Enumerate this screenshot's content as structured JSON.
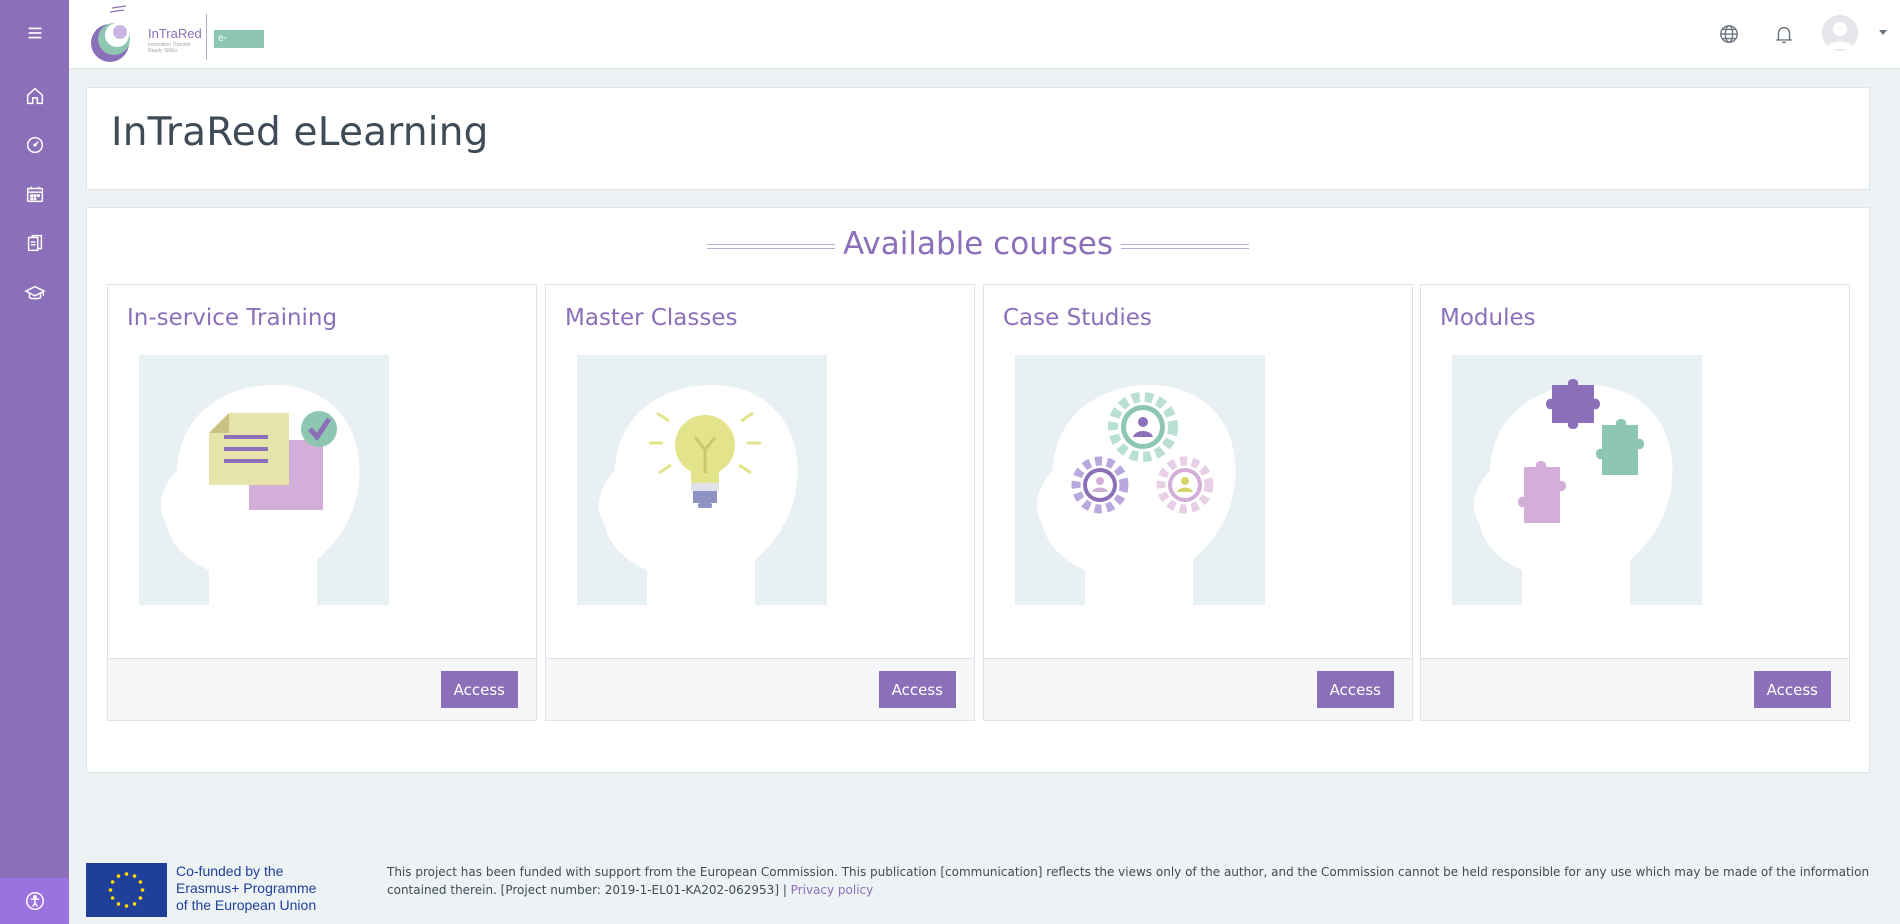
{
  "app": {
    "logo_name": "InTraRed",
    "logo_tagline": "Innovation Transfer Ready SMEs",
    "logo_badge": "e-learning"
  },
  "sidebar": {
    "items": [
      {
        "name": "menu",
        "icon": "hamburger-icon"
      },
      {
        "name": "home",
        "icon": "home-icon"
      },
      {
        "name": "dashboard",
        "icon": "dashboard-icon"
      },
      {
        "name": "calendar",
        "icon": "calendar-icon"
      },
      {
        "name": "content-bank",
        "icon": "files-icon"
      },
      {
        "name": "my-courses",
        "icon": "graduation-cap-icon"
      }
    ],
    "accessibility_icon": "accessibility-icon"
  },
  "header": {
    "icons": [
      "globe-icon",
      "bell-icon",
      "user-avatar"
    ]
  },
  "page": {
    "title": "InTraRed eLearning"
  },
  "courses": {
    "heading": "Available courses",
    "items": [
      {
        "title": "In-service Training",
        "button": "Access",
        "image": "document-check-icon"
      },
      {
        "title": "Master Classes",
        "button": "Access",
        "image": "lightbulb-icon"
      },
      {
        "title": "Case Studies",
        "button": "Access",
        "image": "people-gears-icon"
      },
      {
        "title": "Modules",
        "button": "Access",
        "image": "puzzle-icon"
      }
    ]
  },
  "footer": {
    "eu_line1": "Co-funded by the",
    "eu_line2": "Erasmus+ Programme",
    "eu_line3": "of the European Union",
    "disclaimer": "This project has been funded with support from the European Commission. This publication [communication] reflects the views only of the author, and the Commission cannot be held responsible for any use which may be made of the information contained therein. [Project number: 2019-1-EL01-KA202-062953] | ",
    "privacy_link": "Privacy policy"
  },
  "colors": {
    "brand_purple": "#8b6fb8",
    "accent_green": "#8dc7b2",
    "eu_blue": "#1f3f99",
    "background": "#edf2f5"
  }
}
